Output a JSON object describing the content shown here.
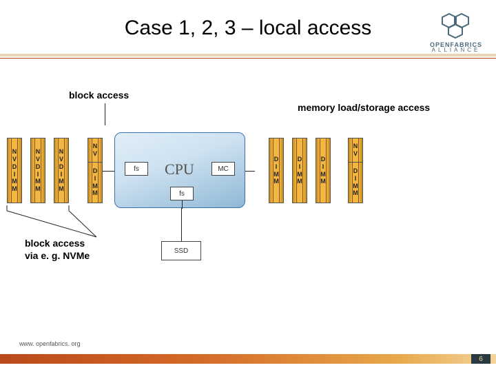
{
  "title": "Case 1, 2, 3 – local access",
  "logo": {
    "line1": "OPENFABRICS",
    "line2": "ALLIANCE"
  },
  "labels": {
    "block_access": "block access",
    "memory_access": "memory load/storage access",
    "block_caption_l1": "block access",
    "block_caption_l2": "via e. g. NVMe"
  },
  "bars": {
    "nvdimm": "NVDIMM",
    "nv": "NV",
    "dimm": "DIMM"
  },
  "cpu": {
    "label": "CPU",
    "fs": "fs",
    "mc": "MC",
    "ssd": "SSD"
  },
  "footer": {
    "url": "www. openfabrics. org",
    "page": "6"
  }
}
